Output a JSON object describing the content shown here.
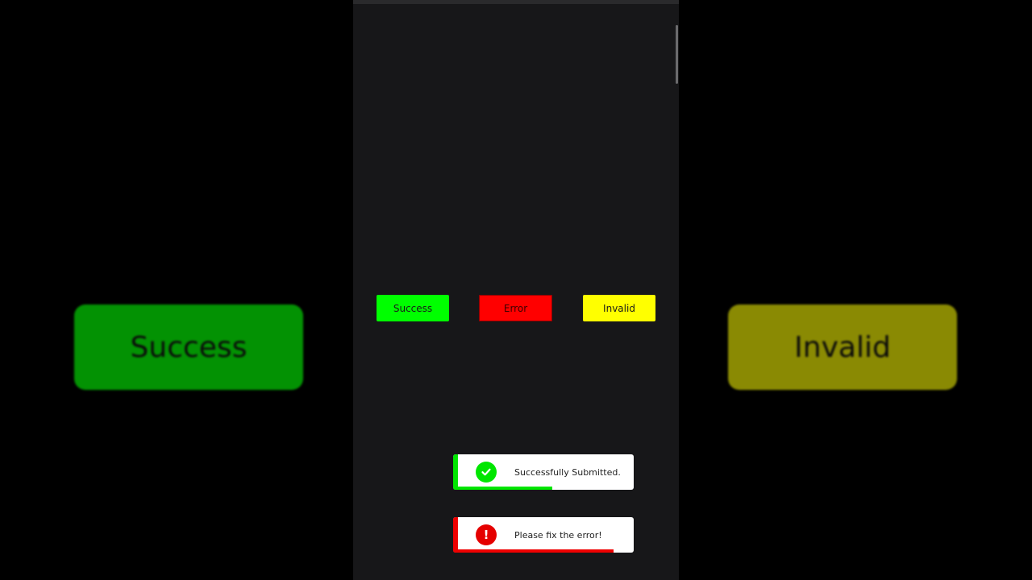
{
  "background": {
    "left_label": "Success",
    "right_label": "Invalid"
  },
  "buttons": {
    "success_label": "Success",
    "error_label": "Error",
    "invalid_label": "Invalid"
  },
  "toasts": {
    "success": {
      "message": "Successfully Submitted.",
      "icon": "check-icon",
      "progress": 0.55
    },
    "error": {
      "message": "Please fix the error!",
      "icon": "exclamation-icon",
      "progress": 0.89
    }
  },
  "colors": {
    "success": "#00ff00",
    "error": "#ff0000",
    "invalid": "#ffff00",
    "panel": "#171719"
  }
}
